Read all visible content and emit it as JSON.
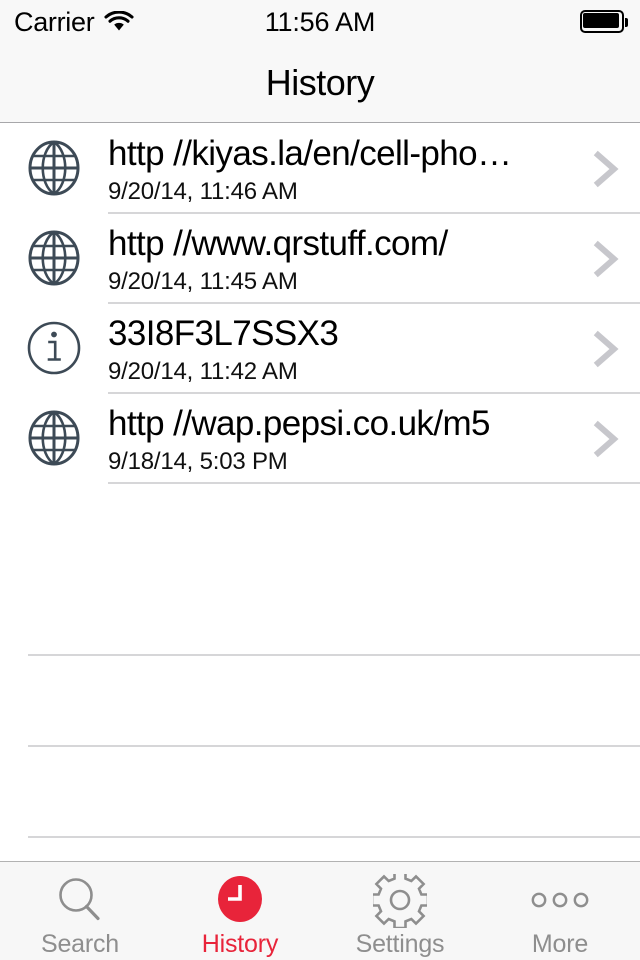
{
  "status_bar": {
    "carrier": "Carrier",
    "wifi_icon": "wifi-icon",
    "time": "11:56 AM",
    "battery_icon": "battery-full-icon"
  },
  "navbar": {
    "title": "History"
  },
  "list": {
    "rows": [
      {
        "icon": "globe-icon",
        "title": "http //kiyas.la/en/cell-pho…",
        "subtitle": "9/20/14, 11:46 AM",
        "accessory": "chevron-right-icon"
      },
      {
        "icon": "globe-icon",
        "title": "http //www.qrstuff.com/",
        "subtitle": "9/20/14, 11:45 AM",
        "accessory": "chevron-right-icon"
      },
      {
        "icon": "info-icon",
        "title": "33I8F3L7SSX3",
        "subtitle": "9/20/14, 11:42 AM",
        "accessory": "chevron-right-icon"
      },
      {
        "icon": "globe-icon",
        "title": "http //wap.pepsi.co.uk/m5",
        "subtitle": "9/18/14, 5:03 PM",
        "accessory": "chevron-right-icon"
      }
    ],
    "empty_row_count": 4
  },
  "tabbar": {
    "items": [
      {
        "label": "Search",
        "icon": "magnifier-icon",
        "active": false
      },
      {
        "label": "History",
        "icon": "clock-icon",
        "active": true
      },
      {
        "label": "Settings",
        "icon": "gear-icon",
        "active": false
      },
      {
        "label": "More",
        "icon": "ellipsis-icon",
        "active": false
      }
    ]
  },
  "colors": {
    "accent": "#E8243A",
    "bar_background": "#F7F7F7",
    "separator": "#D6D6D8",
    "icon_slate": "#3D4A56",
    "inactive_tab": "#8E8E8E",
    "chevron": "#C7C7CC"
  }
}
